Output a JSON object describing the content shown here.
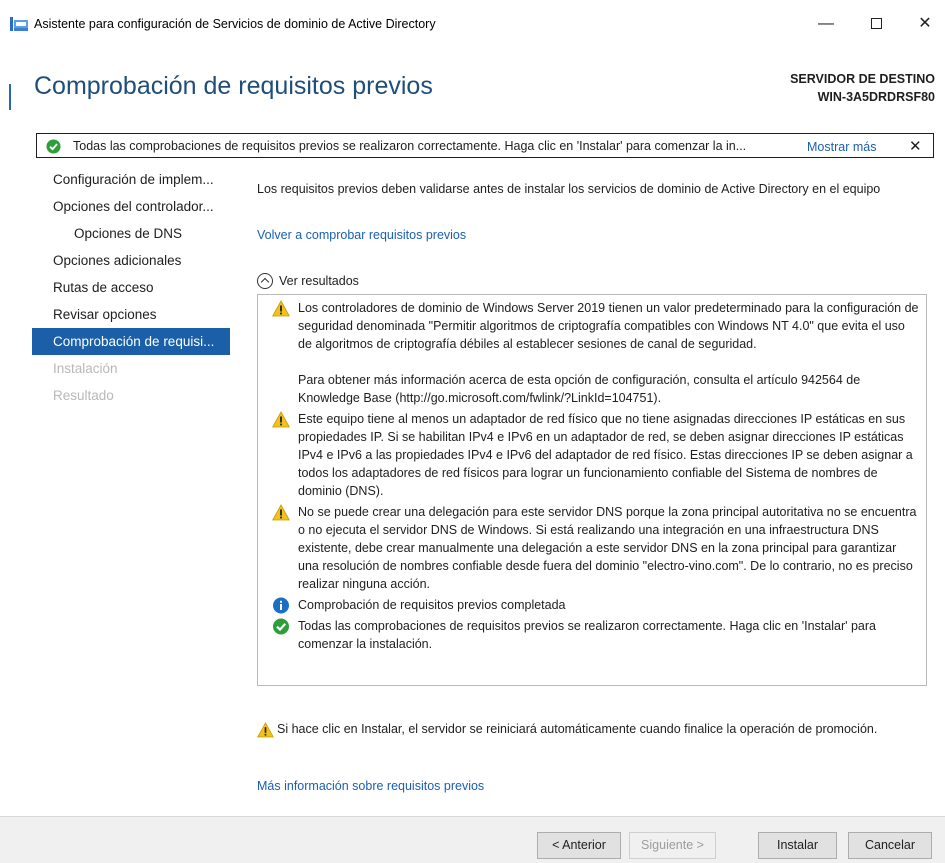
{
  "window": {
    "title": "Asistente para configuración de Servicios de dominio de Active Directory",
    "minimize_glyph": "—",
    "close_glyph": "✕"
  },
  "header": {
    "page_title": "Comprobación de requisitos previos",
    "server_label": "SERVIDOR DE DESTINO",
    "server_name": "WIN-3A5DRDRSF80"
  },
  "notice": {
    "icon": "check-circle-icon",
    "text": "Todas las comprobaciones de requisitos previos se realizaron correctamente. Haga clic en 'Instalar' para comenzar la in...",
    "more_link": "Mostrar más",
    "close_glyph": "✕"
  },
  "sidebar": {
    "items": [
      {
        "label": "Configuración de implem...",
        "state": "normal"
      },
      {
        "label": "Opciones del controlador...",
        "state": "normal"
      },
      {
        "label": "Opciones de DNS",
        "state": "sub"
      },
      {
        "label": "Opciones adicionales",
        "state": "normal"
      },
      {
        "label": "Rutas de acceso",
        "state": "normal"
      },
      {
        "label": "Revisar opciones",
        "state": "normal"
      },
      {
        "label": "Comprobación de requisi...",
        "state": "active"
      },
      {
        "label": "Instalación",
        "state": "disabled"
      },
      {
        "label": "Resultado",
        "state": "disabled"
      }
    ]
  },
  "main": {
    "intro": "Los requisitos previos deben validarse antes de instalar los servicios de dominio de Active Directory en el equipo",
    "recheck_link": "Volver a comprobar requisitos previos",
    "toggle_label": "Ver resultados",
    "results": [
      {
        "icon": "warning-icon",
        "paragraphs": [
          "Los controladores de dominio de Windows Server 2019 tienen un valor predeterminado para la configuración de seguridad denominada \"Permitir algoritmos de criptografía compatibles con Windows NT 4.0\" que evita el uso de algoritmos de criptografía débiles al establecer sesiones de canal de seguridad.",
          "Para obtener más información acerca de esta opción de configuración, consulta el artículo 942564 de Knowledge Base (http://go.microsoft.com/fwlink/?LinkId=104751)."
        ]
      },
      {
        "icon": "warning-icon",
        "paragraphs": [
          "Este equipo tiene al menos un adaptador de red físico que no tiene asignadas direcciones IP estáticas en sus propiedades IP. Si se habilitan IPv4 e IPv6 en un adaptador de red, se deben asignar direcciones IP estáticas IPv4 e IPv6 a las propiedades IPv4 e IPv6 del adaptador de red físico. Estas direcciones IP se deben asignar a todos los adaptadores de red físicos para lograr un funcionamiento confiable del Sistema de nombres de dominio (DNS)."
        ]
      },
      {
        "icon": "warning-icon",
        "paragraphs": [
          "No se puede crear una delegación para este servidor DNS porque la zona principal autoritativa no se encuentra o no ejecuta el servidor DNS de Windows. Si está realizando una integración en una infraestructura DNS existente, debe crear manualmente una delegación a este servidor DNS en la zona principal para garantizar una resolución de nombres confiable desde fuera del dominio \"electro-vino.com\". De lo contrario, no es preciso realizar ninguna acción."
        ]
      },
      {
        "icon": "info-icon",
        "paragraphs": [
          "Comprobación de requisitos previos completada"
        ]
      },
      {
        "icon": "check-circle-icon",
        "paragraphs": [
          "Todas las comprobaciones de requisitos previos se realizaron correctamente. Haga clic en 'Instalar' para comenzar la instalación."
        ]
      }
    ],
    "footer_warning": "Si hace clic en Instalar, el servidor se reiniciará automáticamente cuando finalice la operación de promoción.",
    "more_info_link": "Más información sobre requisitos previos"
  },
  "buttons": {
    "previous": "< Anterior",
    "next": "Siguiente >",
    "install": "Instalar",
    "cancel": "Cancelar"
  },
  "colors": {
    "accent": "#1a5fa8",
    "link": "#1a5fb4",
    "title": "#1f4e79",
    "warning": "#f2c21b",
    "success": "#2e9e3a",
    "info": "#1a6fc4"
  }
}
